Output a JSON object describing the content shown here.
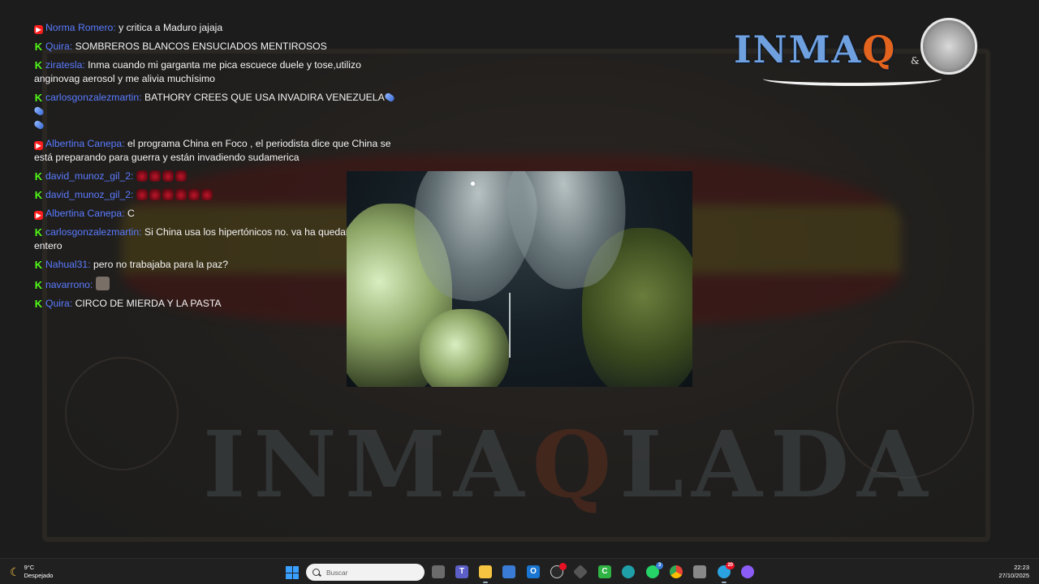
{
  "chat": {
    "messages": [
      {
        "platform": "youtube",
        "user": "Norma Romero",
        "text": "y critica a Maduro jajaja"
      },
      {
        "platform": "kick",
        "user": "Quira",
        "text": "SOMBREROS BLANCOS ENSUCIADOS MENTIROSOS"
      },
      {
        "platform": "kick",
        "user": "ziratesla",
        "text": "Inma cuando mi garganta me pica escuece duele y tose,utilizo anginovag aerosol y me alivia muchísimo"
      },
      {
        "platform": "kick",
        "user": "carlosgonzalezmartin",
        "text": "BATHORY CREES QUE USA INVADIRA VENEZUELA"
      },
      {
        "platform": "youtube",
        "user": "Albertina Canepa",
        "text": "el programa China en Foco , el periodista dice que China se está preparando para guerra y están invadiendo sudamerica"
      },
      {
        "platform": "kick",
        "user": "david_munoz_gil_2",
        "text": ""
      },
      {
        "platform": "kick",
        "user": "david_munoz_gil_2",
        "text": ""
      },
      {
        "platform": "youtube",
        "user": "Albertina Canepa",
        "text": "C"
      },
      {
        "platform": "kick",
        "user": "carlosgonzalezmartin",
        "text": "Si China usa los hipertónicos no. va ha quedar un navío entero"
      },
      {
        "platform": "kick",
        "user": "Nahual31",
        "text": "pero no trabajaba para la paz?"
      },
      {
        "platform": "kick",
        "user": "navarrono",
        "text": ""
      },
      {
        "platform": "kick",
        "user": "Quira",
        "text": "CIRCO DE MIERDA Y LA PASTA"
      }
    ],
    "colors": {
      "username": "#5a7bff",
      "youtube": "#ff1e1e",
      "kick": "#53fc18"
    },
    "icons": {
      "youtube": "youtube-icon",
      "kick": "kick-icon",
      "emote_devil": "devil-emote-icon",
      "emote_face": "face-emote-icon",
      "emote_pill": "pill-emote-icon"
    }
  },
  "logo": {
    "text_a": "INMA",
    "text_q": "Q",
    "amp": "&"
  },
  "background": {
    "watermark_a": "INMA",
    "watermark_q": "Q",
    "watermark_b": "LADA"
  },
  "taskbar": {
    "weather_temp": "9°C",
    "weather_desc": "Despejado",
    "search_placeholder": "Buscar",
    "time": "22:23",
    "date": "27/10/2025",
    "whatsapp_badge": "3",
    "telegram_badge": "20"
  }
}
